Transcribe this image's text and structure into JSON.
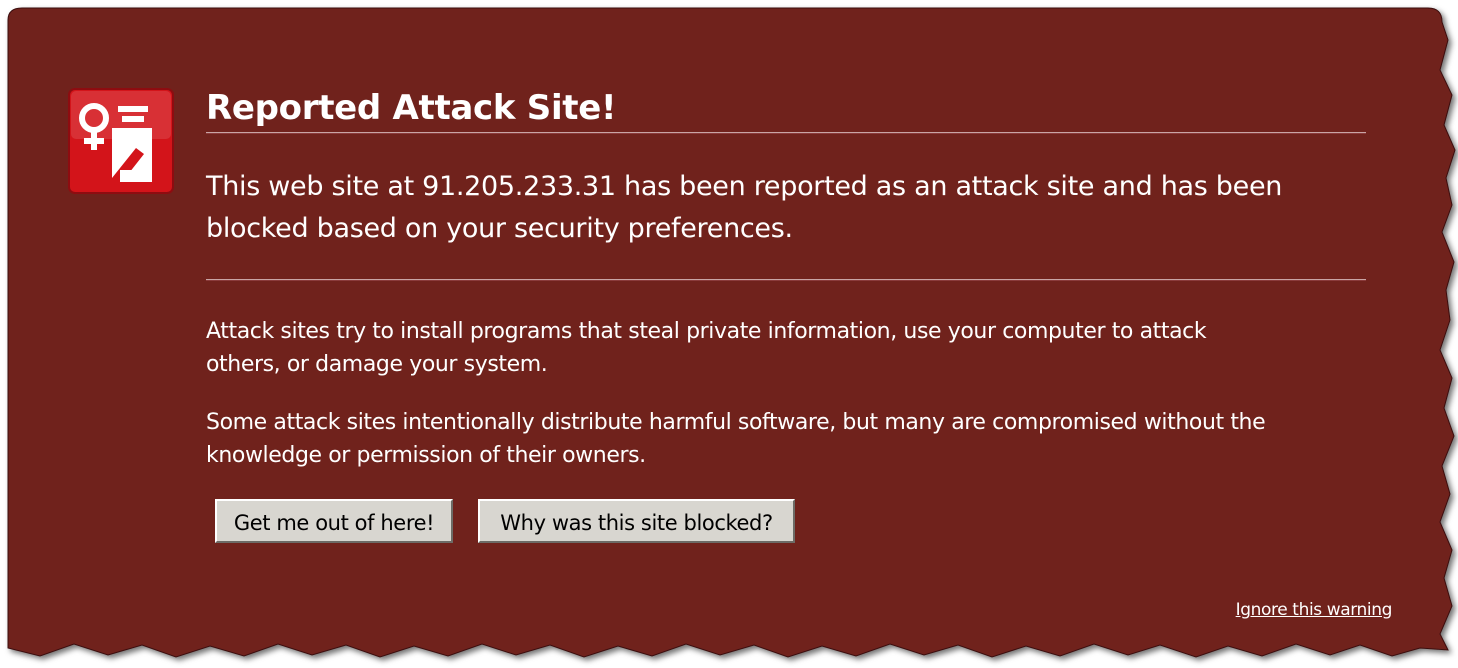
{
  "colors": {
    "background": "#70211f",
    "text": "#ffffff",
    "icon_bg": "#d3141a",
    "button_face": "#d8d6d0"
  },
  "warning": {
    "icon": "attack-site-guard-icon",
    "title": "Reported Attack Site!",
    "short_desc": "This web site at 91.205.233.31 has been reported as an attack site and has been blocked based on your security preferences.",
    "long_desc_1": "Attack sites try to install programs that steal private information, use your computer to attack others, or damage your system.",
    "long_desc_2": "Some attack sites intentionally distribute harmful software, but many are compromised without the knowledge or permission of their owners.",
    "get_me_out_label": "Get me out of here!",
    "why_blocked_label": "Why was this site blocked?",
    "ignore_label": "Ignore this warning"
  }
}
